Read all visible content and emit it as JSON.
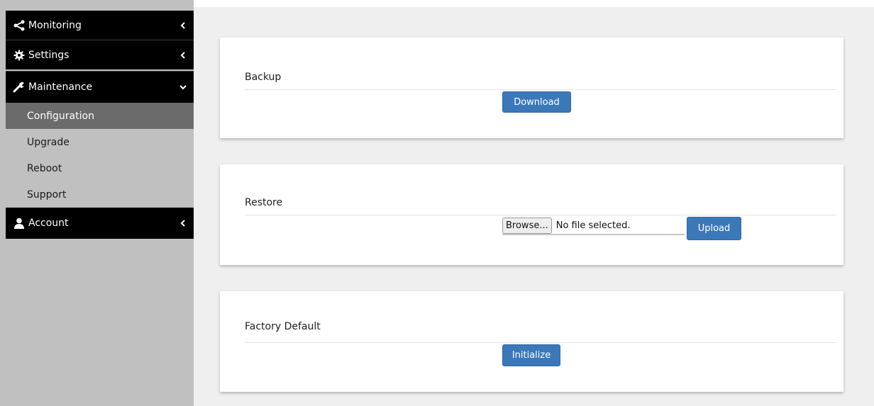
{
  "sidebar": {
    "monitoring": {
      "label": "Monitoring",
      "icon": "share-icon",
      "chevron": "chevron-left-icon"
    },
    "settings": {
      "label": "Settings",
      "icon": "gear-icon",
      "chevron": "chevron-left-icon"
    },
    "maintenance": {
      "label": "Maintenance",
      "icon": "wrench-icon",
      "chevron": "chevron-down-icon",
      "items": [
        {
          "label": "Configuration",
          "active": true
        },
        {
          "label": "Upgrade",
          "active": false
        },
        {
          "label": "Reboot",
          "active": false
        },
        {
          "label": "Support",
          "active": false
        }
      ]
    },
    "account": {
      "label": "Account",
      "icon": "user-icon",
      "chevron": "chevron-left-icon"
    }
  },
  "panels": {
    "backup": {
      "title": "Backup",
      "button": "Download"
    },
    "restore": {
      "title": "Restore",
      "browse": "Browse...",
      "file_status": "No file selected.",
      "button": "Upload"
    },
    "factory": {
      "title": "Factory Default",
      "button": "Initialize"
    }
  },
  "colors": {
    "sidebar_bg": "#c0c0c0",
    "nav_black": "#000000",
    "active_item": "#6b6b6b",
    "main_bg": "#efefef",
    "button": "#3b78ba"
  }
}
